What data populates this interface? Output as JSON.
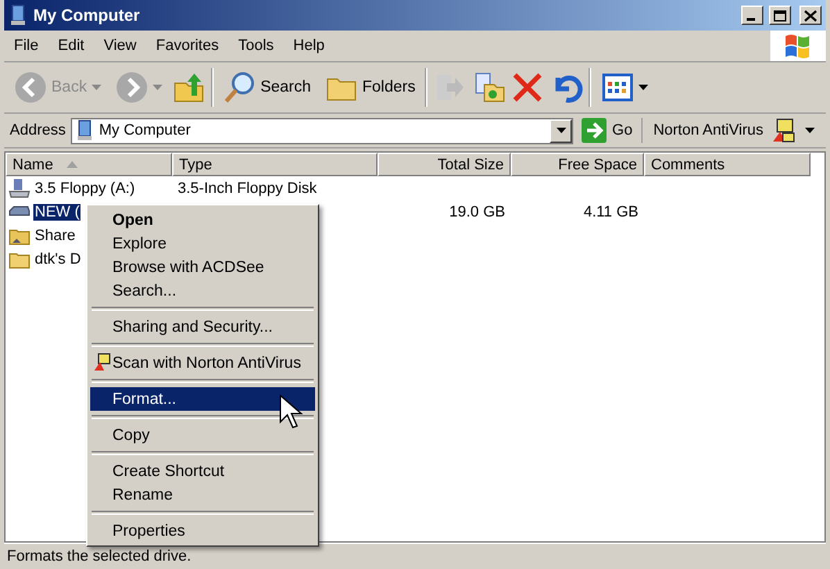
{
  "window": {
    "title": "My Computer"
  },
  "menu_bar": [
    "File",
    "Edit",
    "View",
    "Favorites",
    "Tools",
    "Help"
  ],
  "toolbar": {
    "back": {
      "label": "Back",
      "disabled": true
    },
    "search": "Search",
    "folders": "Folders"
  },
  "address_bar": {
    "label": "Address",
    "value": "My Computer",
    "go": "Go",
    "norton": "Norton AntiVirus"
  },
  "table": {
    "columns": [
      "Name",
      "Type",
      "Total Size",
      "Free Space",
      "Comments"
    ],
    "rows": [
      {
        "kind": "floppy",
        "name": "3.5 Floppy (A:)",
        "type": "3.5-Inch Floppy Disk",
        "total": "",
        "free": "",
        "selected": false
      },
      {
        "kind": "drive",
        "name": "NEW (",
        "type": "",
        "total": "19.0 GB",
        "free": "4.11 GB",
        "selected": true
      },
      {
        "kind": "shared",
        "name": "Share",
        "type": "",
        "total": "",
        "free": "",
        "selected": false
      },
      {
        "kind": "folder",
        "name": "dtk's D",
        "type": "",
        "total": "",
        "free": "",
        "selected": false
      }
    ]
  },
  "context_menu": [
    {
      "kind": "item",
      "label": "Open",
      "default": true,
      "selected": false
    },
    {
      "kind": "item",
      "label": "Explore",
      "default": false,
      "selected": false
    },
    {
      "kind": "item",
      "label": "Browse with ACDSee",
      "default": false,
      "selected": false
    },
    {
      "kind": "item",
      "label": "Search...",
      "default": false,
      "selected": false
    },
    {
      "kind": "separator"
    },
    {
      "kind": "item",
      "label": "Sharing and Security...",
      "default": false,
      "selected": false
    },
    {
      "kind": "separator"
    },
    {
      "kind": "norton",
      "label": "Scan with Norton AntiVirus",
      "default": false,
      "selected": false
    },
    {
      "kind": "separator"
    },
    {
      "kind": "item",
      "label": "Format...",
      "default": false,
      "selected": true
    },
    {
      "kind": "separator"
    },
    {
      "kind": "item",
      "label": "Copy",
      "default": false,
      "selected": false
    },
    {
      "kind": "separator"
    },
    {
      "kind": "item",
      "label": "Create Shortcut",
      "default": false,
      "selected": false
    },
    {
      "kind": "item",
      "label": "Rename",
      "default": false,
      "selected": false
    },
    {
      "kind": "separator"
    },
    {
      "kind": "item",
      "label": "Properties",
      "default": false,
      "selected": false
    }
  ],
  "status_bar": "Formats the selected drive."
}
